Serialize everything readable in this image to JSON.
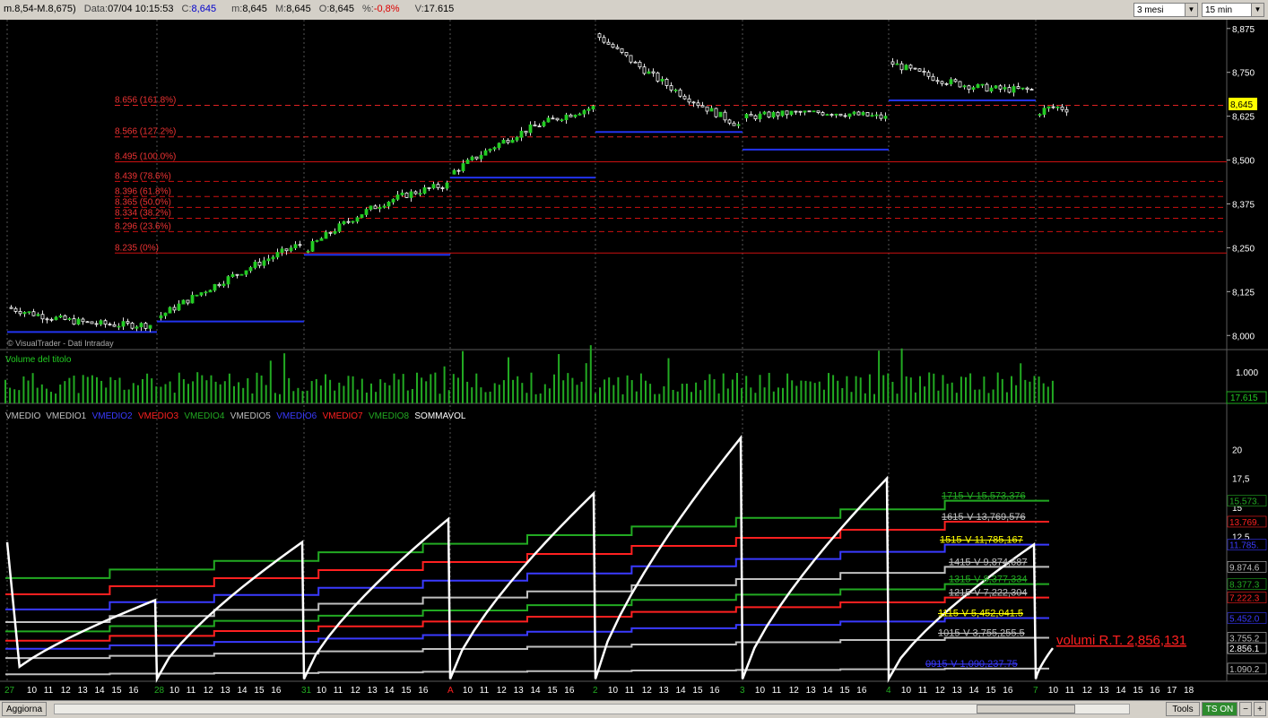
{
  "header": {
    "instrument": "m.8,54-M.8,675)",
    "data_label": "Data:",
    "data_value": "07/04 10:15:53",
    "c_label": "C:",
    "c_value": "8,645",
    "m_label": "m:",
    "m_value": "8,645",
    "M_label": "M:",
    "M_value": "8,645",
    "o_label": "O:",
    "o_value": "8,645",
    "pct_label": "%:",
    "pct_value": "-0,8%",
    "v_label": "V:",
    "v_value": "17.615",
    "period_select": "3 mesi",
    "interval_select": "15 min"
  },
  "footer": {
    "aggiorna": "Aggiorna",
    "tools": "Tools",
    "tson": "TS ON",
    "minus": "−",
    "plus": "+"
  },
  "price_panel": {
    "watermark": "© VisualTrader - Dati Intraday",
    "ylim": [
      7.97,
      8.9
    ],
    "y_ticks": [
      "8,875",
      "8,750",
      "8,625",
      "8,500",
      "8,375",
      "8,250",
      "8,125",
      "8,000"
    ],
    "last_price_label": "8,645",
    "fibonacci": [
      {
        "label": "8.656 (161.8%)",
        "value": 8.656
      },
      {
        "label": "8.566 (127.2%)",
        "value": 8.566
      },
      {
        "label": "8.495 (100.0%)",
        "value": 8.495
      },
      {
        "label": "8.439 (78.6%)",
        "value": 8.439
      },
      {
        "label": "8.396 (61.8%)",
        "value": 8.396
      },
      {
        "label": "8.365 (50.0%)",
        "value": 8.365
      },
      {
        "label": "8.334 (38.2%)",
        "value": 8.334
      },
      {
        "label": "8.296 (23.6%)",
        "value": 8.296
      },
      {
        "label": "8.235 (0%)",
        "value": 8.235
      }
    ]
  },
  "volume_panel": {
    "title": "Volume del titolo",
    "tick_label": "1.000",
    "last_label": "17.615"
  },
  "indicator_panel": {
    "legend": [
      {
        "name": "VMEDIO",
        "color": "#c0c0c0"
      },
      {
        "name": "VMEDIO1",
        "color": "#c0c0c0"
      },
      {
        "name": "VMEDIO2",
        "color": "#3a3aff"
      },
      {
        "name": "VMEDIO3",
        "color": "#ff2020"
      },
      {
        "name": "VMEDIO4",
        "color": "#22aa22"
      },
      {
        "name": "VMEDIO5",
        "color": "#c0c0c0"
      },
      {
        "name": "VMEDIO6",
        "color": "#3a3aff"
      },
      {
        "name": "VMEDIO7",
        "color": "#ff2020"
      },
      {
        "name": "VMEDIO8",
        "color": "#22aa22"
      },
      {
        "name": "SOMMAVOL",
        "color": "#ffffff"
      }
    ],
    "y_ticks": [
      "20",
      "17,5",
      "15",
      "12,5"
    ],
    "right_labels": [
      {
        "text": "15.573.",
        "color": "#22aa22",
        "bg": "#000"
      },
      {
        "text": "13.769.",
        "color": "#ff2020",
        "bg": "#000"
      },
      {
        "text": "11.785.",
        "color": "#3a3aff",
        "bg": "#000"
      },
      {
        "text": "9.874.6",
        "color": "#c0c0c0",
        "bg": "#000"
      },
      {
        "text": "8.377.3",
        "color": "#22aa22",
        "bg": "#000"
      },
      {
        "text": "7.222.3",
        "color": "#ff2020",
        "bg": "#000"
      },
      {
        "text": "5.452.0",
        "color": "#3a3aff",
        "bg": "#000"
      },
      {
        "text": "3.755.2",
        "color": "#c0c0c0",
        "bg": "#000"
      },
      {
        "text": "2.856.1",
        "color": "#ffffff",
        "bg": "#000"
      },
      {
        "text": "1.090.2",
        "color": "#c0c0c0",
        "bg": "#000"
      }
    ],
    "line_labels": [
      {
        "text": "1715-V 15,573,376",
        "color": "#22aa22"
      },
      {
        "text": "1615-V 13,769,576",
        "color": "#c0c0c0"
      },
      {
        "text": "1515-V 11,785,167",
        "color": "#ffff00"
      },
      {
        "text": "1415-V 9,874,687",
        "color": "#c0c0c0"
      },
      {
        "text": "1315-V 8,377,334",
        "color": "#22aa22"
      },
      {
        "text": "1215-V 7,222,304",
        "color": "#c0c0c0"
      },
      {
        "text": "1115-V 5,452,041.5",
        "color": "#ffff00"
      },
      {
        "text": "1015-V 3,755,255.5",
        "color": "#c0c0c0"
      },
      {
        "text": "0915-V 1,090,237.75",
        "color": "#3a3aff"
      }
    ],
    "volumi_rt": "volumi R.T. 2,856,131"
  },
  "x_axis": {
    "days": [
      {
        "label": "27",
        "color": "#22aa22",
        "hours": [
          "10",
          "11",
          "12",
          "13",
          "14",
          "15",
          "16"
        ]
      },
      {
        "label": "28",
        "color": "#22aa22",
        "hours": [
          "10",
          "11",
          "12",
          "13",
          "14",
          "15",
          "16"
        ]
      },
      {
        "label": "31",
        "color": "#22aa22",
        "hours": [
          "10",
          "11",
          "12",
          "13",
          "14",
          "15",
          "16"
        ]
      },
      {
        "label": "A",
        "color": "#ff2020",
        "hours": [
          "10",
          "11",
          "12",
          "13",
          "14",
          "15",
          "16"
        ]
      },
      {
        "label": "2",
        "color": "#22aa22",
        "hours": [
          "10",
          "11",
          "12",
          "13",
          "14",
          "15",
          "16"
        ]
      },
      {
        "label": "3",
        "color": "#22aa22",
        "hours": [
          "10",
          "11",
          "12",
          "13",
          "14",
          "15",
          "16"
        ]
      },
      {
        "label": "4",
        "color": "#22aa22",
        "hours": [
          "10",
          "11",
          "12",
          "13",
          "14",
          "15",
          "16"
        ]
      },
      {
        "label": "7",
        "color": "#22aa22",
        "hours": [
          "10",
          "11",
          "12",
          "13",
          "14",
          "15",
          "16",
          "17",
          "18"
        ]
      }
    ]
  },
  "chart_data": {
    "type": "candlestick",
    "interval": "15 min",
    "ylim": [
      7.97,
      8.9
    ],
    "days": [
      {
        "day": "27",
        "open": 8.08,
        "close": 8.03,
        "high": 8.09,
        "low": 8.01
      },
      {
        "day": "28",
        "open": 8.05,
        "close": 8.26,
        "high": 8.27,
        "low": 8.04
      },
      {
        "day": "31",
        "open": 8.24,
        "close": 8.43,
        "high": 8.47,
        "low": 8.23
      },
      {
        "day": "A",
        "open": 8.46,
        "close": 8.65,
        "high": 8.68,
        "low": 8.45
      },
      {
        "day": "2",
        "open": 8.86,
        "close": 8.6,
        "high": 8.88,
        "low": 8.58
      },
      {
        "day": "3",
        "open": 8.62,
        "close": 8.62,
        "high": 8.64,
        "low": 8.53
      },
      {
        "day": "4",
        "open": 8.78,
        "close": 8.7,
        "high": 8.8,
        "low": 8.67
      },
      {
        "day": "7",
        "open": 8.63,
        "close": 8.645,
        "high": 8.66,
        "low": 8.56
      }
    ],
    "last_volume": 17615,
    "volume_ylim": [
      0,
      1500
    ]
  }
}
